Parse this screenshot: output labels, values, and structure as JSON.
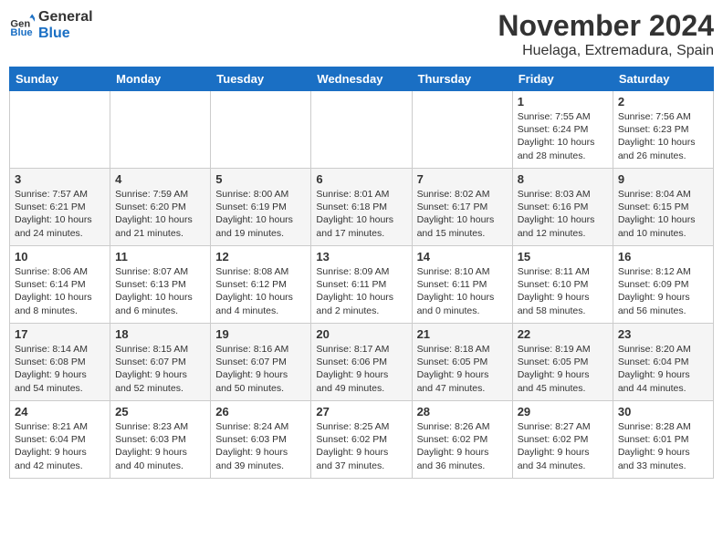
{
  "logo": {
    "line1": "General",
    "line2": "Blue"
  },
  "title": "November 2024",
  "location": "Huelaga, Extremadura, Spain",
  "days_of_week": [
    "Sunday",
    "Monday",
    "Tuesday",
    "Wednesday",
    "Thursday",
    "Friday",
    "Saturday"
  ],
  "weeks": [
    [
      {
        "day": "",
        "info": ""
      },
      {
        "day": "",
        "info": ""
      },
      {
        "day": "",
        "info": ""
      },
      {
        "day": "",
        "info": ""
      },
      {
        "day": "",
        "info": ""
      },
      {
        "day": "1",
        "info": "Sunrise: 7:55 AM\nSunset: 6:24 PM\nDaylight: 10 hours and 28 minutes."
      },
      {
        "day": "2",
        "info": "Sunrise: 7:56 AM\nSunset: 6:23 PM\nDaylight: 10 hours and 26 minutes."
      }
    ],
    [
      {
        "day": "3",
        "info": "Sunrise: 7:57 AM\nSunset: 6:21 PM\nDaylight: 10 hours and 24 minutes."
      },
      {
        "day": "4",
        "info": "Sunrise: 7:59 AM\nSunset: 6:20 PM\nDaylight: 10 hours and 21 minutes."
      },
      {
        "day": "5",
        "info": "Sunrise: 8:00 AM\nSunset: 6:19 PM\nDaylight: 10 hours and 19 minutes."
      },
      {
        "day": "6",
        "info": "Sunrise: 8:01 AM\nSunset: 6:18 PM\nDaylight: 10 hours and 17 minutes."
      },
      {
        "day": "7",
        "info": "Sunrise: 8:02 AM\nSunset: 6:17 PM\nDaylight: 10 hours and 15 minutes."
      },
      {
        "day": "8",
        "info": "Sunrise: 8:03 AM\nSunset: 6:16 PM\nDaylight: 10 hours and 12 minutes."
      },
      {
        "day": "9",
        "info": "Sunrise: 8:04 AM\nSunset: 6:15 PM\nDaylight: 10 hours and 10 minutes."
      }
    ],
    [
      {
        "day": "10",
        "info": "Sunrise: 8:06 AM\nSunset: 6:14 PM\nDaylight: 10 hours and 8 minutes."
      },
      {
        "day": "11",
        "info": "Sunrise: 8:07 AM\nSunset: 6:13 PM\nDaylight: 10 hours and 6 minutes."
      },
      {
        "day": "12",
        "info": "Sunrise: 8:08 AM\nSunset: 6:12 PM\nDaylight: 10 hours and 4 minutes."
      },
      {
        "day": "13",
        "info": "Sunrise: 8:09 AM\nSunset: 6:11 PM\nDaylight: 10 hours and 2 minutes."
      },
      {
        "day": "14",
        "info": "Sunrise: 8:10 AM\nSunset: 6:11 PM\nDaylight: 10 hours and 0 minutes."
      },
      {
        "day": "15",
        "info": "Sunrise: 8:11 AM\nSunset: 6:10 PM\nDaylight: 9 hours and 58 minutes."
      },
      {
        "day": "16",
        "info": "Sunrise: 8:12 AM\nSunset: 6:09 PM\nDaylight: 9 hours and 56 minutes."
      }
    ],
    [
      {
        "day": "17",
        "info": "Sunrise: 8:14 AM\nSunset: 6:08 PM\nDaylight: 9 hours and 54 minutes."
      },
      {
        "day": "18",
        "info": "Sunrise: 8:15 AM\nSunset: 6:07 PM\nDaylight: 9 hours and 52 minutes."
      },
      {
        "day": "19",
        "info": "Sunrise: 8:16 AM\nSunset: 6:07 PM\nDaylight: 9 hours and 50 minutes."
      },
      {
        "day": "20",
        "info": "Sunrise: 8:17 AM\nSunset: 6:06 PM\nDaylight: 9 hours and 49 minutes."
      },
      {
        "day": "21",
        "info": "Sunrise: 8:18 AM\nSunset: 6:05 PM\nDaylight: 9 hours and 47 minutes."
      },
      {
        "day": "22",
        "info": "Sunrise: 8:19 AM\nSunset: 6:05 PM\nDaylight: 9 hours and 45 minutes."
      },
      {
        "day": "23",
        "info": "Sunrise: 8:20 AM\nSunset: 6:04 PM\nDaylight: 9 hours and 44 minutes."
      }
    ],
    [
      {
        "day": "24",
        "info": "Sunrise: 8:21 AM\nSunset: 6:04 PM\nDaylight: 9 hours and 42 minutes."
      },
      {
        "day": "25",
        "info": "Sunrise: 8:23 AM\nSunset: 6:03 PM\nDaylight: 9 hours and 40 minutes."
      },
      {
        "day": "26",
        "info": "Sunrise: 8:24 AM\nSunset: 6:03 PM\nDaylight: 9 hours and 39 minutes."
      },
      {
        "day": "27",
        "info": "Sunrise: 8:25 AM\nSunset: 6:02 PM\nDaylight: 9 hours and 37 minutes."
      },
      {
        "day": "28",
        "info": "Sunrise: 8:26 AM\nSunset: 6:02 PM\nDaylight: 9 hours and 36 minutes."
      },
      {
        "day": "29",
        "info": "Sunrise: 8:27 AM\nSunset: 6:02 PM\nDaylight: 9 hours and 34 minutes."
      },
      {
        "day": "30",
        "info": "Sunrise: 8:28 AM\nSunset: 6:01 PM\nDaylight: 9 hours and 33 minutes."
      }
    ]
  ]
}
